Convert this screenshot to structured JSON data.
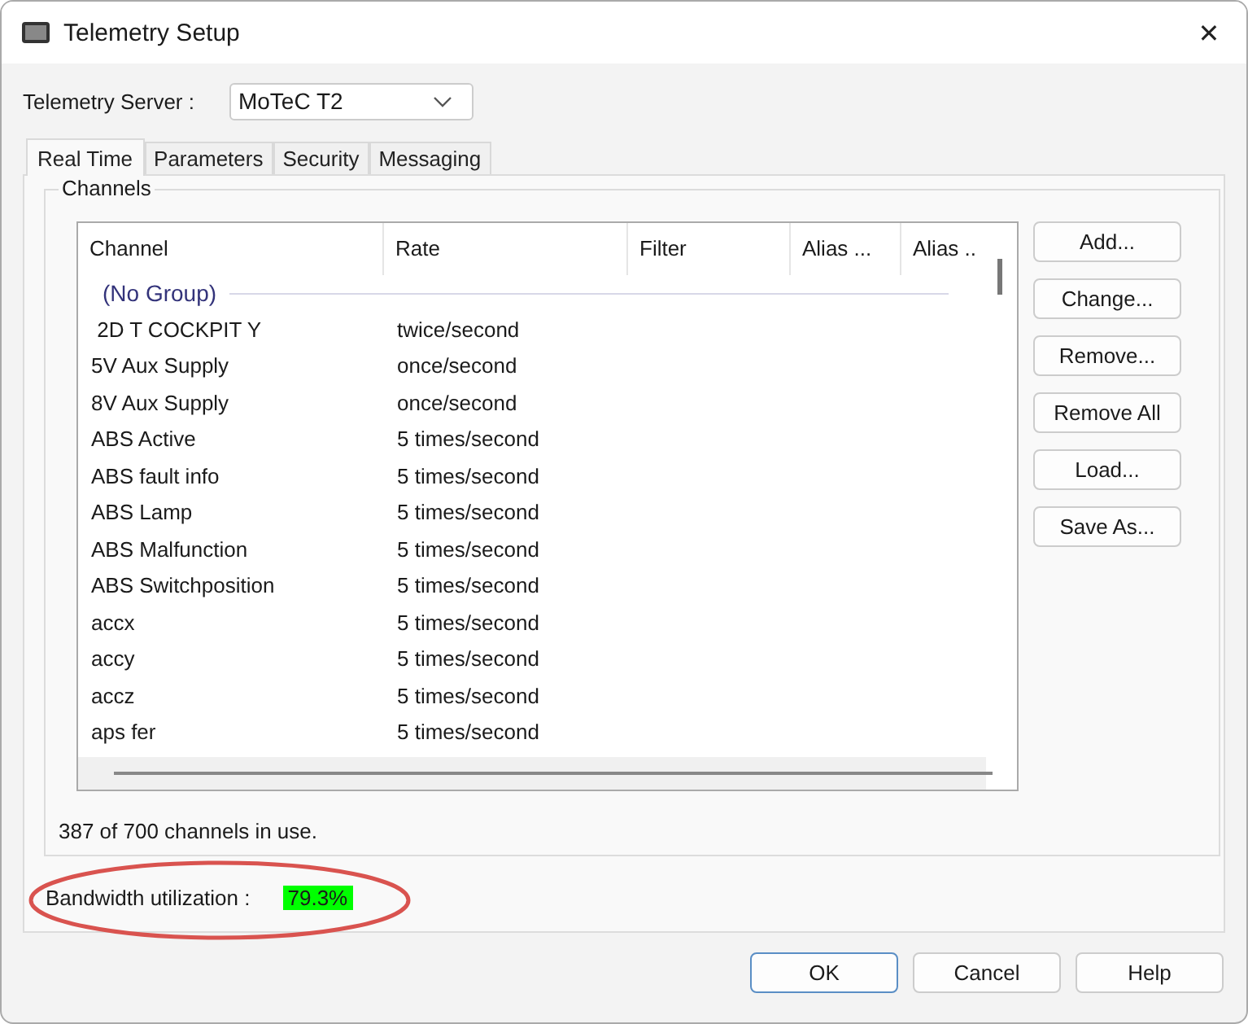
{
  "window": {
    "title": "Telemetry Setup",
    "close": "✕"
  },
  "server": {
    "label": "Telemetry Server :",
    "value": "MoTeC T2"
  },
  "tabs": [
    {
      "label": "Real Time",
      "selected": true
    },
    {
      "label": "Parameters",
      "selected": false
    },
    {
      "label": "Security",
      "selected": false
    },
    {
      "label": "Messaging",
      "selected": false
    }
  ],
  "channels": {
    "title": "Channels",
    "columns": [
      "Channel",
      "Rate",
      "Filter",
      "Alias ...",
      "Alias .."
    ],
    "group": "(No Group)",
    "rows": [
      {
        "channel": " 2D T COCKPIT Y",
        "rate": "twice/second"
      },
      {
        "channel": "5V Aux Supply",
        "rate": "once/second"
      },
      {
        "channel": "8V Aux Supply",
        "rate": "once/second"
      },
      {
        "channel": "ABS Active",
        "rate": "5 times/second"
      },
      {
        "channel": "ABS fault info",
        "rate": "5 times/second"
      },
      {
        "channel": "ABS Lamp",
        "rate": "5 times/second"
      },
      {
        "channel": "ABS Malfunction",
        "rate": "5 times/second"
      },
      {
        "channel": "ABS Switchposition",
        "rate": "5 times/second"
      },
      {
        "channel": "accx",
        "rate": "5 times/second"
      },
      {
        "channel": "accy",
        "rate": "5 times/second"
      },
      {
        "channel": "accz",
        "rate": "5 times/second"
      },
      {
        "channel": "aps fer",
        "rate": "5 times/second"
      }
    ],
    "buttons": [
      "Add...",
      "Change...",
      "Remove...",
      "Remove All",
      "Load...",
      "Save As..."
    ],
    "usage": "387 of 700 channels in use."
  },
  "bandwidth": {
    "label": "Bandwidth utilization :",
    "value": "79.3%",
    "color": "#00ff00"
  },
  "buttons": [
    {
      "label": "OK",
      "default": true
    },
    {
      "label": "Cancel",
      "default": false
    },
    {
      "label": "Help",
      "default": false
    }
  ]
}
